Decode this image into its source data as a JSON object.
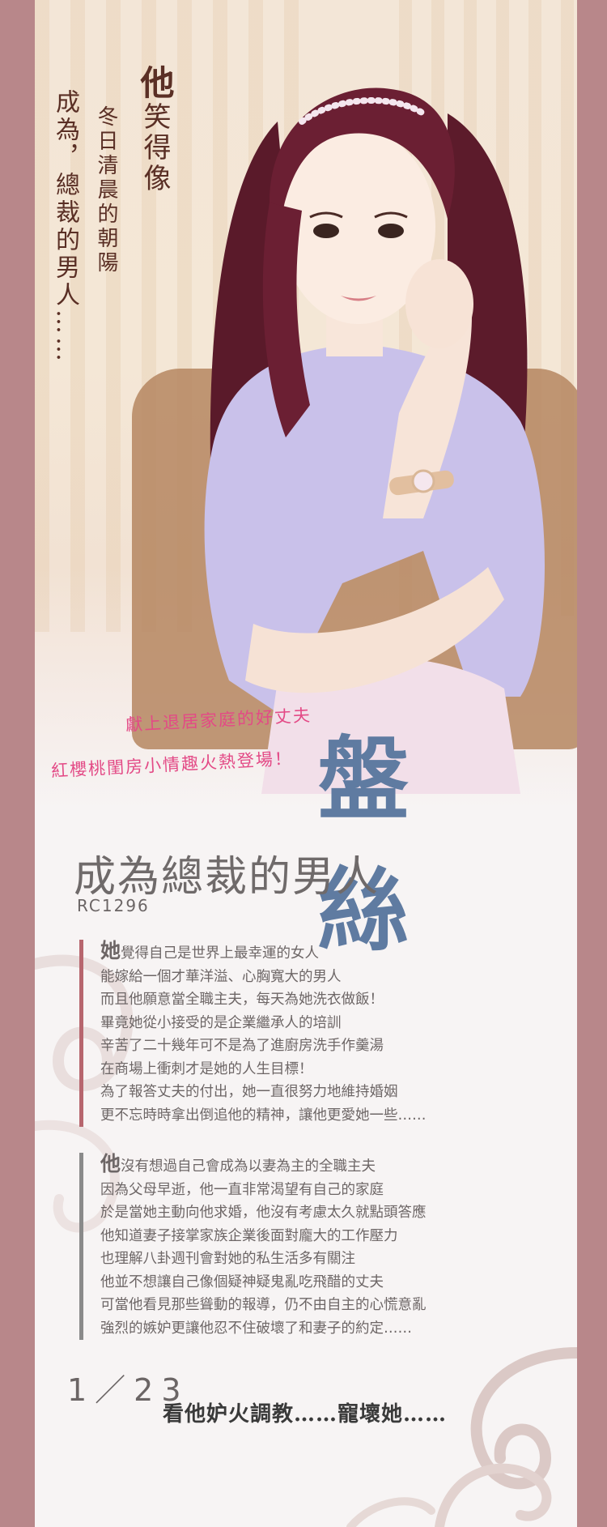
{
  "cover": {
    "vertical_line_1_big": "他",
    "vertical_line_1_rest": "笑得像",
    "vertical_line_2": "冬日清晨的朝陽",
    "vertical_line_3": "成為，總裁的男人……",
    "tagline_1": "獻上退居家庭的好丈夫",
    "tagline_2": "紅櫻桃閨房小情趣火熱登場！",
    "author": "盤絲"
  },
  "book": {
    "title": "成為總裁的男人",
    "code": "RC1296"
  },
  "paragraph_1": {
    "first_char": "她",
    "lines": [
      "覺得自己是世界上最幸運的女人",
      "能嫁給一個才華洋溢、心胸寬大的男人",
      "而且他願意當全職主夫，每天為她洗衣做飯！",
      "畢竟她從小接受的是企業繼承人的培訓",
      "辛苦了二十幾年可不是為了進廚房洗手作羹湯",
      "在商場上衝刺才是她的人生目標！",
      "為了報答丈夫的付出，她一直很努力地維持婚姻",
      "更不忘時時拿出倒追他的精神，讓他更愛她一些……"
    ]
  },
  "paragraph_2": {
    "first_char": "他",
    "lines": [
      "沒有想過自己會成為以妻為主的全職主夫",
      "因為父母早逝，他一直非常渴望有自己的家庭",
      "於是當她主動向他求婚，他沒有考慮太久就點頭答應",
      "他知道妻子接掌家族企業後面對龐大的工作壓力",
      "也理解八卦週刊會對她的私生活多有關注",
      "他並不想讓自己像個疑神疑鬼亂吃飛醋的丈夫",
      "可當他看見那些聳動的報導，仍不由自主的心慌意亂",
      "強烈的嫉妒更讓他忍不住破壞了和妻子的約定……"
    ]
  },
  "release": {
    "date": "1／23",
    "closing": "看他妒火調教……寵壞她……"
  },
  "colors": {
    "frame": "#b8878a",
    "author": "#5f7ba1",
    "tagline": "#e34a86",
    "accent_bar_1": "#b7666e",
    "accent_bar_2": "#8a8a8a"
  }
}
